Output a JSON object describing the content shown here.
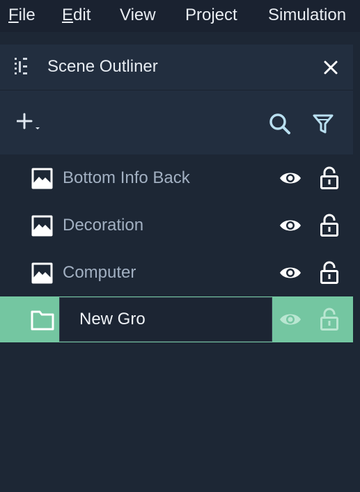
{
  "menu": {
    "items": [
      {
        "label": "File",
        "mnemonic": "F"
      },
      {
        "label": "Edit",
        "mnemonic": "E"
      },
      {
        "label": "View"
      },
      {
        "label": "Project"
      },
      {
        "label": "Simulation"
      }
    ]
  },
  "panel": {
    "title": "Scene Outliner",
    "icons": {
      "outliner": "outliner-icon",
      "close": "close-icon",
      "add": "plus-add-icon",
      "search": "search-icon",
      "filter": "filter-funnel-icon"
    }
  },
  "outliner": {
    "items": [
      {
        "label": "Bottom Info Back",
        "type": "image",
        "visible": true,
        "locked": false
      },
      {
        "label": "Decoration",
        "type": "image",
        "visible": true,
        "locked": false
      },
      {
        "label": "Computer",
        "type": "image",
        "visible": true,
        "locked": false
      },
      {
        "label": "",
        "type": "folder",
        "visible": true,
        "locked": false,
        "selected": true,
        "editing": true
      }
    ],
    "rename": {
      "value": "New Gro"
    }
  },
  "colors": {
    "menubar_bg": "#1a2230",
    "panel_bg": "#1d2735",
    "header_bg": "#222e3f",
    "selection": "#74c6a1",
    "label_text": "#a2b0c2",
    "icon_white": "#ffffff"
  }
}
